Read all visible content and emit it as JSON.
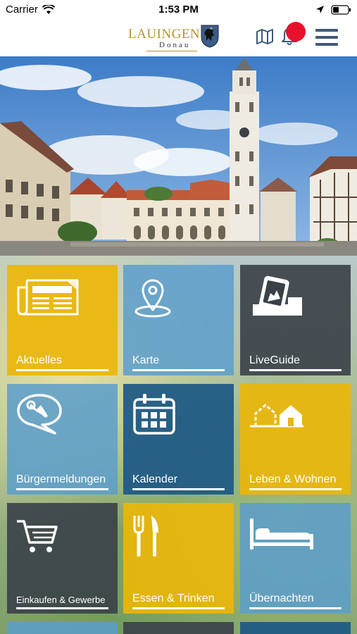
{
  "status": {
    "carrier": "Carrier",
    "time": "1:53 PM"
  },
  "navbar": {
    "logo_main": "LAUINGEN",
    "logo_sub": "Donau",
    "badge_color": "#e8112d"
  },
  "colors": {
    "yellow": "#eab60a",
    "light_blue": "#5a9ecd",
    "dark_blue": "#1c5884",
    "dark_grey": "#3a4048"
  },
  "tiles": [
    {
      "label": "Aktuelles",
      "icon": "newspaper-icon"
    },
    {
      "label": "Karte",
      "icon": "map-pin-icon"
    },
    {
      "label": "LiveGuide",
      "icon": "liveguide-icon"
    },
    {
      "label": "Bürgermeldungen",
      "icon": "wrench-bubble-icon"
    },
    {
      "label": "Kalender",
      "icon": "calendar-icon"
    },
    {
      "label": "Leben & Wohnen",
      "icon": "houses-icon"
    },
    {
      "label": "Einkaufen & Gewerbe",
      "icon": "cart-icon"
    },
    {
      "label": "Essen & Trinken",
      "icon": "fork-knife-icon"
    },
    {
      "label": "Übernachten",
      "icon": "bed-icon"
    }
  ]
}
